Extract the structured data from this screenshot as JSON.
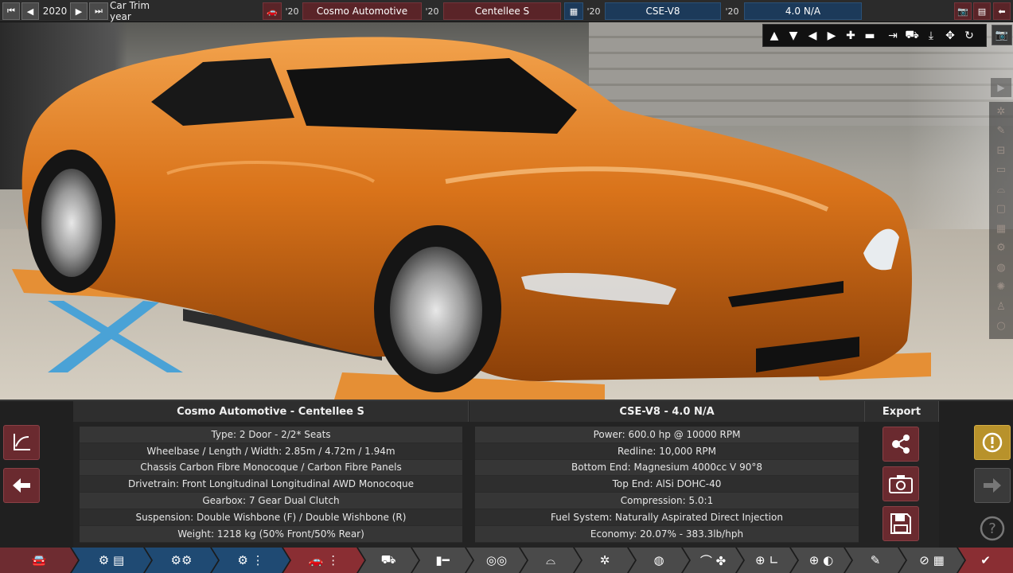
{
  "topbar": {
    "year": "2020",
    "trim_year_label": "Car Trim year",
    "model_year_prefix": "'20",
    "manufacturer": "Cosmo Automotive",
    "trim_year_prefix": "'20",
    "trim": "Centellee S",
    "engine_year_prefix": "'20",
    "engine_family": "CSE-V8",
    "variant_year_prefix": "'20",
    "engine_variant": "4.0 N/A"
  },
  "car_info": {
    "title": "Cosmo Automotive - Centellee S",
    "rows": [
      "Type: 2 Door - 2/2* Seats",
      "Wheelbase / Length / Width: 2.85m / 4.72m / 1.94m",
      "Chassis Carbon Fibre Monocoque / Carbon Fibre Panels",
      "Drivetrain: Front Longitudinal Longitudinal AWD Monocoque",
      "Gearbox: 7 Gear Dual Clutch",
      "Suspension: Double Wishbone (F) / Double Wishbone (R)",
      "Weight: 1218 kg (50% Front/50% Rear)"
    ]
  },
  "engine_info": {
    "title": "CSE-V8 - 4.0 N/A",
    "rows": [
      "Power: 600.0 hp @ 10000 RPM",
      "Redline:  10,000 RPM",
      "Bottom End: Magnesium 4000cc V 90°8",
      "Top End: AlSi DOHC-40",
      "Compression: 5.0:1",
      "Fuel System: Naturally Aspirated Direct Injection",
      "Economy: 20.07% - 383.3lb/hph"
    ]
  },
  "export": {
    "title": "Export"
  },
  "colors": {
    "maroon": "#6e2c31",
    "blue": "#1f4a73",
    "car_paint": "#d9731a",
    "warning": "#b8922b"
  }
}
